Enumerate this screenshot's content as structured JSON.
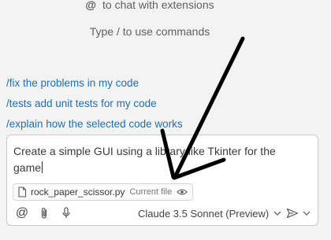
{
  "hints": {
    "extensions_symbol": "@",
    "extensions_text": "to chat with extensions",
    "commands_text": "Type / to use commands"
  },
  "suggestions": [
    "/fix the problems in my code",
    "/tests add unit tests for my code",
    "/explain how the selected code works"
  ],
  "chat_input": {
    "value_visible_line_1": "Create a simple GUI using a li",
    "value_hidden_part": "brary like",
    "value_visible_line_1_end": " Tkinter for the",
    "value_line_2": "game"
  },
  "attached_file": {
    "name": "rock_paper_scissor.py",
    "tag": "Current file",
    "icon": "file-icon",
    "visibility_icon": "eye-icon"
  },
  "toolbar": {
    "mention_label": "@",
    "attach_icon": "paperclip-icon",
    "mic_icon": "microphone-icon",
    "model_label": "Claude 3.5 Sonnet (Preview)",
    "send_icon": "send-icon"
  },
  "colors": {
    "background": "#f3f3f3",
    "suggestion": "#1f6fb2",
    "input_bg": "#ffffff",
    "annotation_arrow": "#000000"
  }
}
